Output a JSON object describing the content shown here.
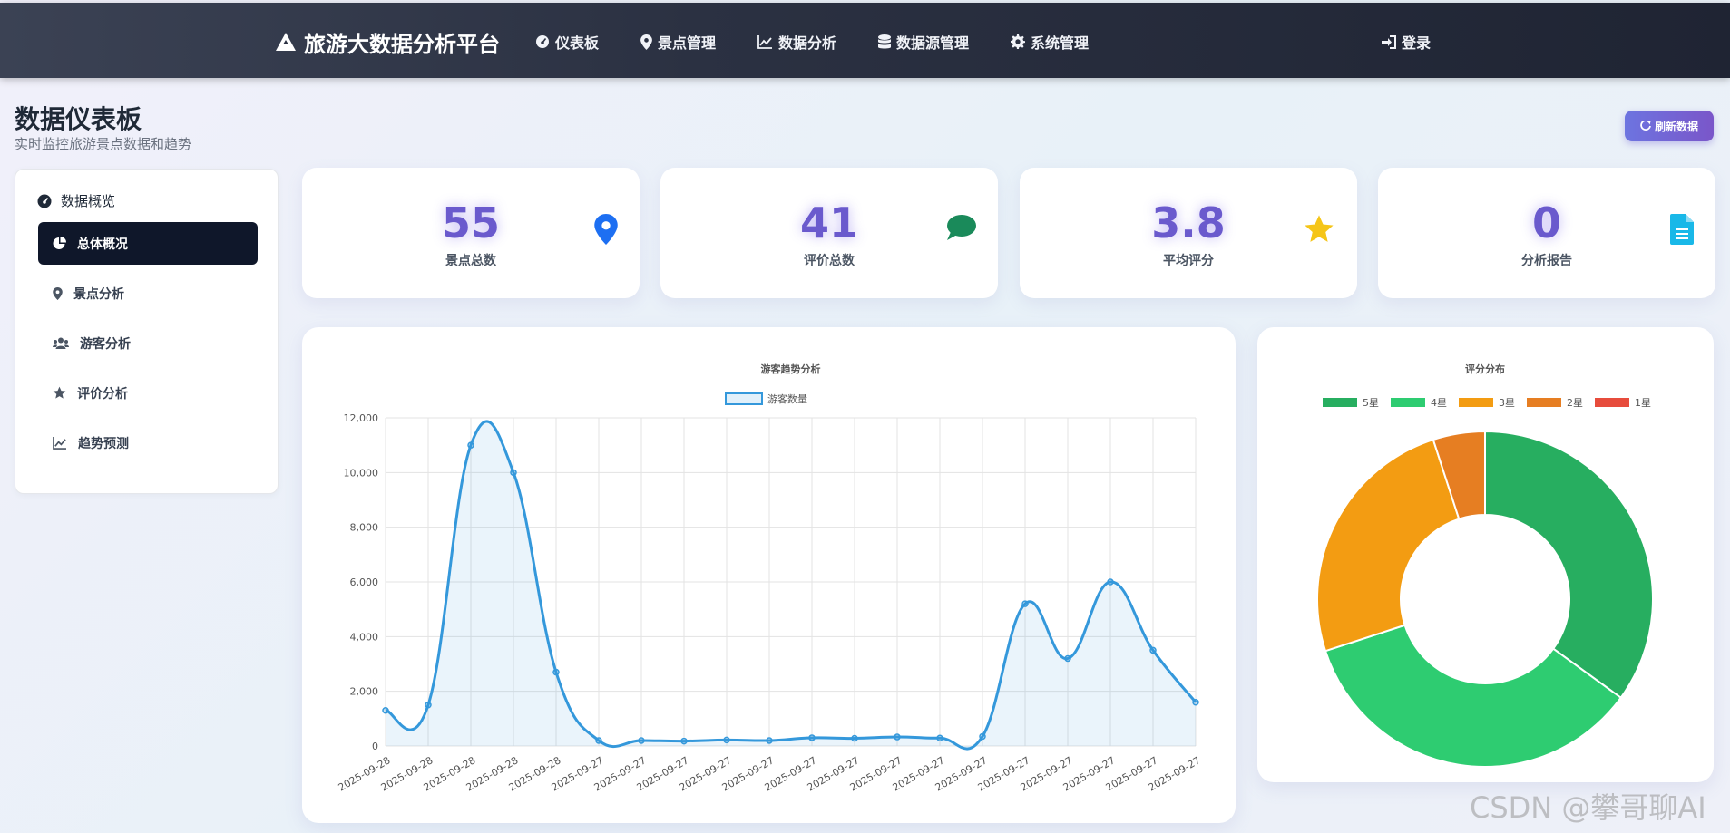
{
  "navbar": {
    "brand": "旅游大数据分析平台",
    "items": [
      {
        "label": "仪表板",
        "icon": "dashboard-icon"
      },
      {
        "label": "景点管理",
        "icon": "map-marker-icon"
      },
      {
        "label": "数据分析",
        "icon": "line-chart-icon"
      },
      {
        "label": "数据源管理",
        "icon": "database-icon"
      },
      {
        "label": "系统管理",
        "icon": "gear-icon"
      }
    ],
    "login": "登录"
  },
  "header": {
    "title": "数据仪表板",
    "subtitle": "实时监控旅游景点数据和趋势",
    "refresh_label": "刷新数据"
  },
  "sidebar": {
    "heading": "数据概览",
    "items": [
      {
        "label": "总体概况",
        "icon": "pie-chart-icon",
        "active": true
      },
      {
        "label": "景点分析",
        "icon": "map-marker-icon",
        "active": false
      },
      {
        "label": "游客分析",
        "icon": "users-icon",
        "active": false
      },
      {
        "label": "评价分析",
        "icon": "star-icon",
        "active": false
      },
      {
        "label": "趋势预测",
        "icon": "line-chart-icon",
        "active": false
      }
    ]
  },
  "stats": [
    {
      "value": "55",
      "label": "景点总数",
      "icon": "map-marker-icon",
      "color": "#1d6ff2"
    },
    {
      "value": "41",
      "label": "评价总数",
      "icon": "comment-icon",
      "color": "#1a8a5a"
    },
    {
      "value": "3.8",
      "label": "平均评分",
      "icon": "star-icon",
      "color": "#f5c518"
    },
    {
      "value": "0",
      "label": "分析报告",
      "icon": "file-icon",
      "color": "#19b8e8"
    }
  ],
  "chart_data": [
    {
      "type": "line",
      "title": "游客趋势分析",
      "legend_position": "top",
      "series": [
        {
          "name": "游客数量",
          "color": "#3498db",
          "values": [
            1300,
            1500,
            11000,
            10000,
            2700,
            200,
            200,
            180,
            220,
            200,
            300,
            280,
            330,
            290,
            350,
            5200,
            3200,
            6000,
            3500,
            1600
          ]
        }
      ],
      "categories": [
        "2025-09-28",
        "2025-09-28",
        "2025-09-28",
        "2025-09-28",
        "2025-09-28",
        "2025-09-27",
        "2025-09-27",
        "2025-09-27",
        "2025-09-27",
        "2025-09-27",
        "2025-09-27",
        "2025-09-27",
        "2025-09-27",
        "2025-09-27",
        "2025-09-27",
        "2025-09-27",
        "2025-09-27",
        "2025-09-27",
        "2025-09-27",
        "2025-09-27"
      ],
      "ylim": [
        0,
        12000
      ],
      "yticks": [
        "0",
        "2,000",
        "4,000",
        "6,000",
        "8,000",
        "10,000",
        "12,000"
      ],
      "grid": true
    },
    {
      "type": "pie",
      "title": "评分分布",
      "legend_position": "top",
      "categories": [
        "5星",
        "4星",
        "3星",
        "2星",
        "1星"
      ],
      "values": [
        35,
        35,
        25,
        5,
        0
      ],
      "colors": [
        "#27ae60",
        "#2ecc71",
        "#f39c12",
        "#e67e22",
        "#e74c3c"
      ]
    }
  ],
  "watermark": "CSDN @攀哥聊AI"
}
